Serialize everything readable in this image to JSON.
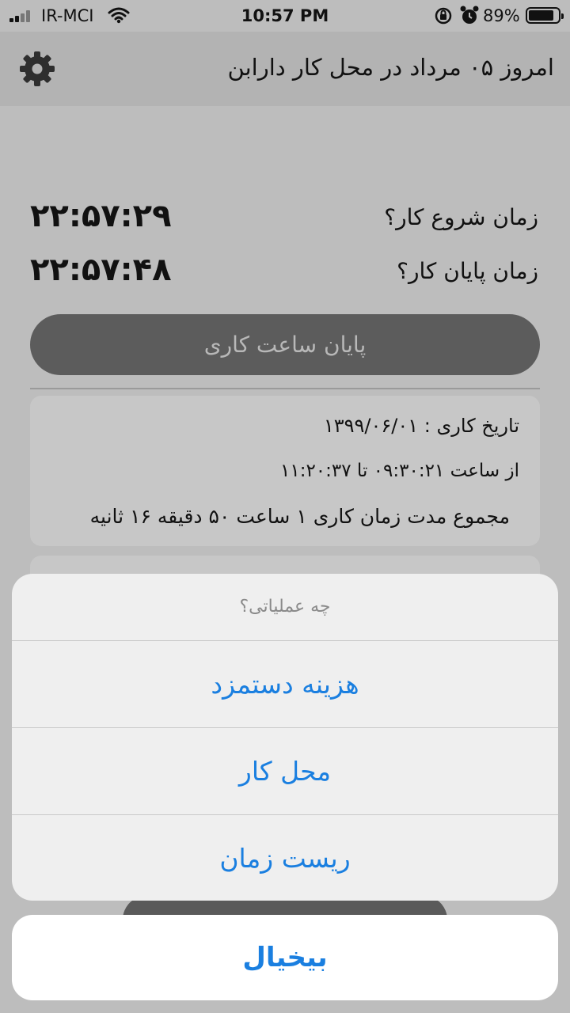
{
  "status_bar": {
    "carrier": "IR-MCI",
    "time": "10:57 PM",
    "battery_percent": "89%",
    "icons": [
      "signal-icon",
      "wifi-icon",
      "rotation-lock-icon",
      "alarm-icon",
      "battery-icon"
    ]
  },
  "header": {
    "title": "امروز ۰۵ مرداد در محل کار دارابن",
    "settings_icon": "gear-icon"
  },
  "work": {
    "start_label": "زمان شروع کار؟",
    "start_time": "۲۲:۵۷:۲۹",
    "end_label": "زمان پایان کار؟",
    "end_time": "۲۲:۵۷:۴۸",
    "end_button_label": "پایان ساعت کاری"
  },
  "record": {
    "date_line": "تاریخ کاری : ۱۳۹۹/۰۶/۰۱",
    "range_line": "از ساعت ۰۹:۳۰:۲۱ تا ۱۱:۲۰:۳۷",
    "total_line": "مجموع مدت زمان کاری ۱ ساعت ۵۰ دقیقه ۱۶ ثانیه"
  },
  "action_sheet": {
    "title": "چه عملیاتی؟",
    "items": [
      {
        "label": "هزینه دستمزد"
      },
      {
        "label": "محل کار"
      },
      {
        "label": "ریست زمان"
      }
    ],
    "cancel_label": "بیخیال"
  },
  "colors": {
    "accent": "#1a7fe0",
    "overlay_bg": "#bdbdbd",
    "button_dark": "#5c5c5c"
  }
}
